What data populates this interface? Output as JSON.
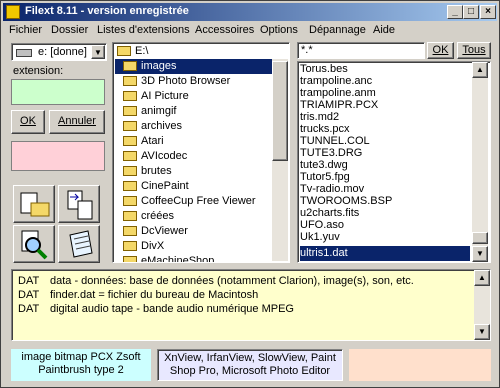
{
  "window": {
    "title": "Filext 8.11 - version enregistrée",
    "minimize": "_",
    "maximize": "□",
    "close": "×"
  },
  "menu": [
    "Fichier",
    "Dossier",
    "Listes d'extensions",
    "Accessoires",
    "Options",
    "Dépannage",
    "Aide"
  ],
  "left": {
    "drive": "e: [donne]",
    "extension_label": "extension:",
    "extension_value": "",
    "ok_label": "OK",
    "annuler_label": "Annuler",
    "pink_box_value": ""
  },
  "folders": {
    "current_path": "E:\\",
    "items": [
      "images",
      "3D Photo Browser",
      "AI Picture",
      "animgif",
      "archives",
      "Atari",
      "AVIcodec",
      "brutes",
      "CinePaint",
      "CoffeeCup Free Viewer",
      "créées",
      "DcViewer",
      "DivX",
      "eMachineShop"
    ]
  },
  "files": {
    "filter": "*.*",
    "ok_label": "OK",
    "tous_label": "Tous",
    "items": [
      "Torus.bes",
      "trampoline.anc",
      "trampoline.anm",
      "TRIAMIPR.PCX",
      "tris.md2",
      "trucks.pcx",
      "TUNNEL.COL",
      "TUTE3.DRG",
      "tute3.dwg",
      "Tutor5.fpg",
      "Tv-radio.mov",
      "TWOROOMS.BSP",
      "u2charts.fits",
      "UFO.aso",
      "Uk1.yuv",
      "ultris1.dat"
    ],
    "selected_index": 15
  },
  "descriptions": [
    {
      "ext": "DAT",
      "text": "data - données: base de données (notamment Clarion), image(s), son, etc."
    },
    {
      "ext": "DAT",
      "text": "finder.dat = fichier du bureau de Macintosh"
    },
    {
      "ext": "DAT",
      "text": "digital audio tape - bande audio numérique MPEG"
    }
  ],
  "status": {
    "type_line1": "image bitmap PCX Zsoft",
    "type_line2": "Paintbrush type 2",
    "programs_line1": "XnView, IrfanView, SlowView, Paint",
    "programs_line2": "Shop Pro, Microsoft Photo Editor",
    "right": ""
  },
  "colors": {
    "title_start": "#0a246a",
    "title_end": "#a6caf0",
    "selection": "#0a246a",
    "extension_field": "#ccffcc",
    "pink_field": "#ffd0d8",
    "desc_bg": "#ffffcc",
    "status_cyan": "#ccffff",
    "status_lavender": "#e8e8ff",
    "status_peach": "#ffe0cc"
  }
}
